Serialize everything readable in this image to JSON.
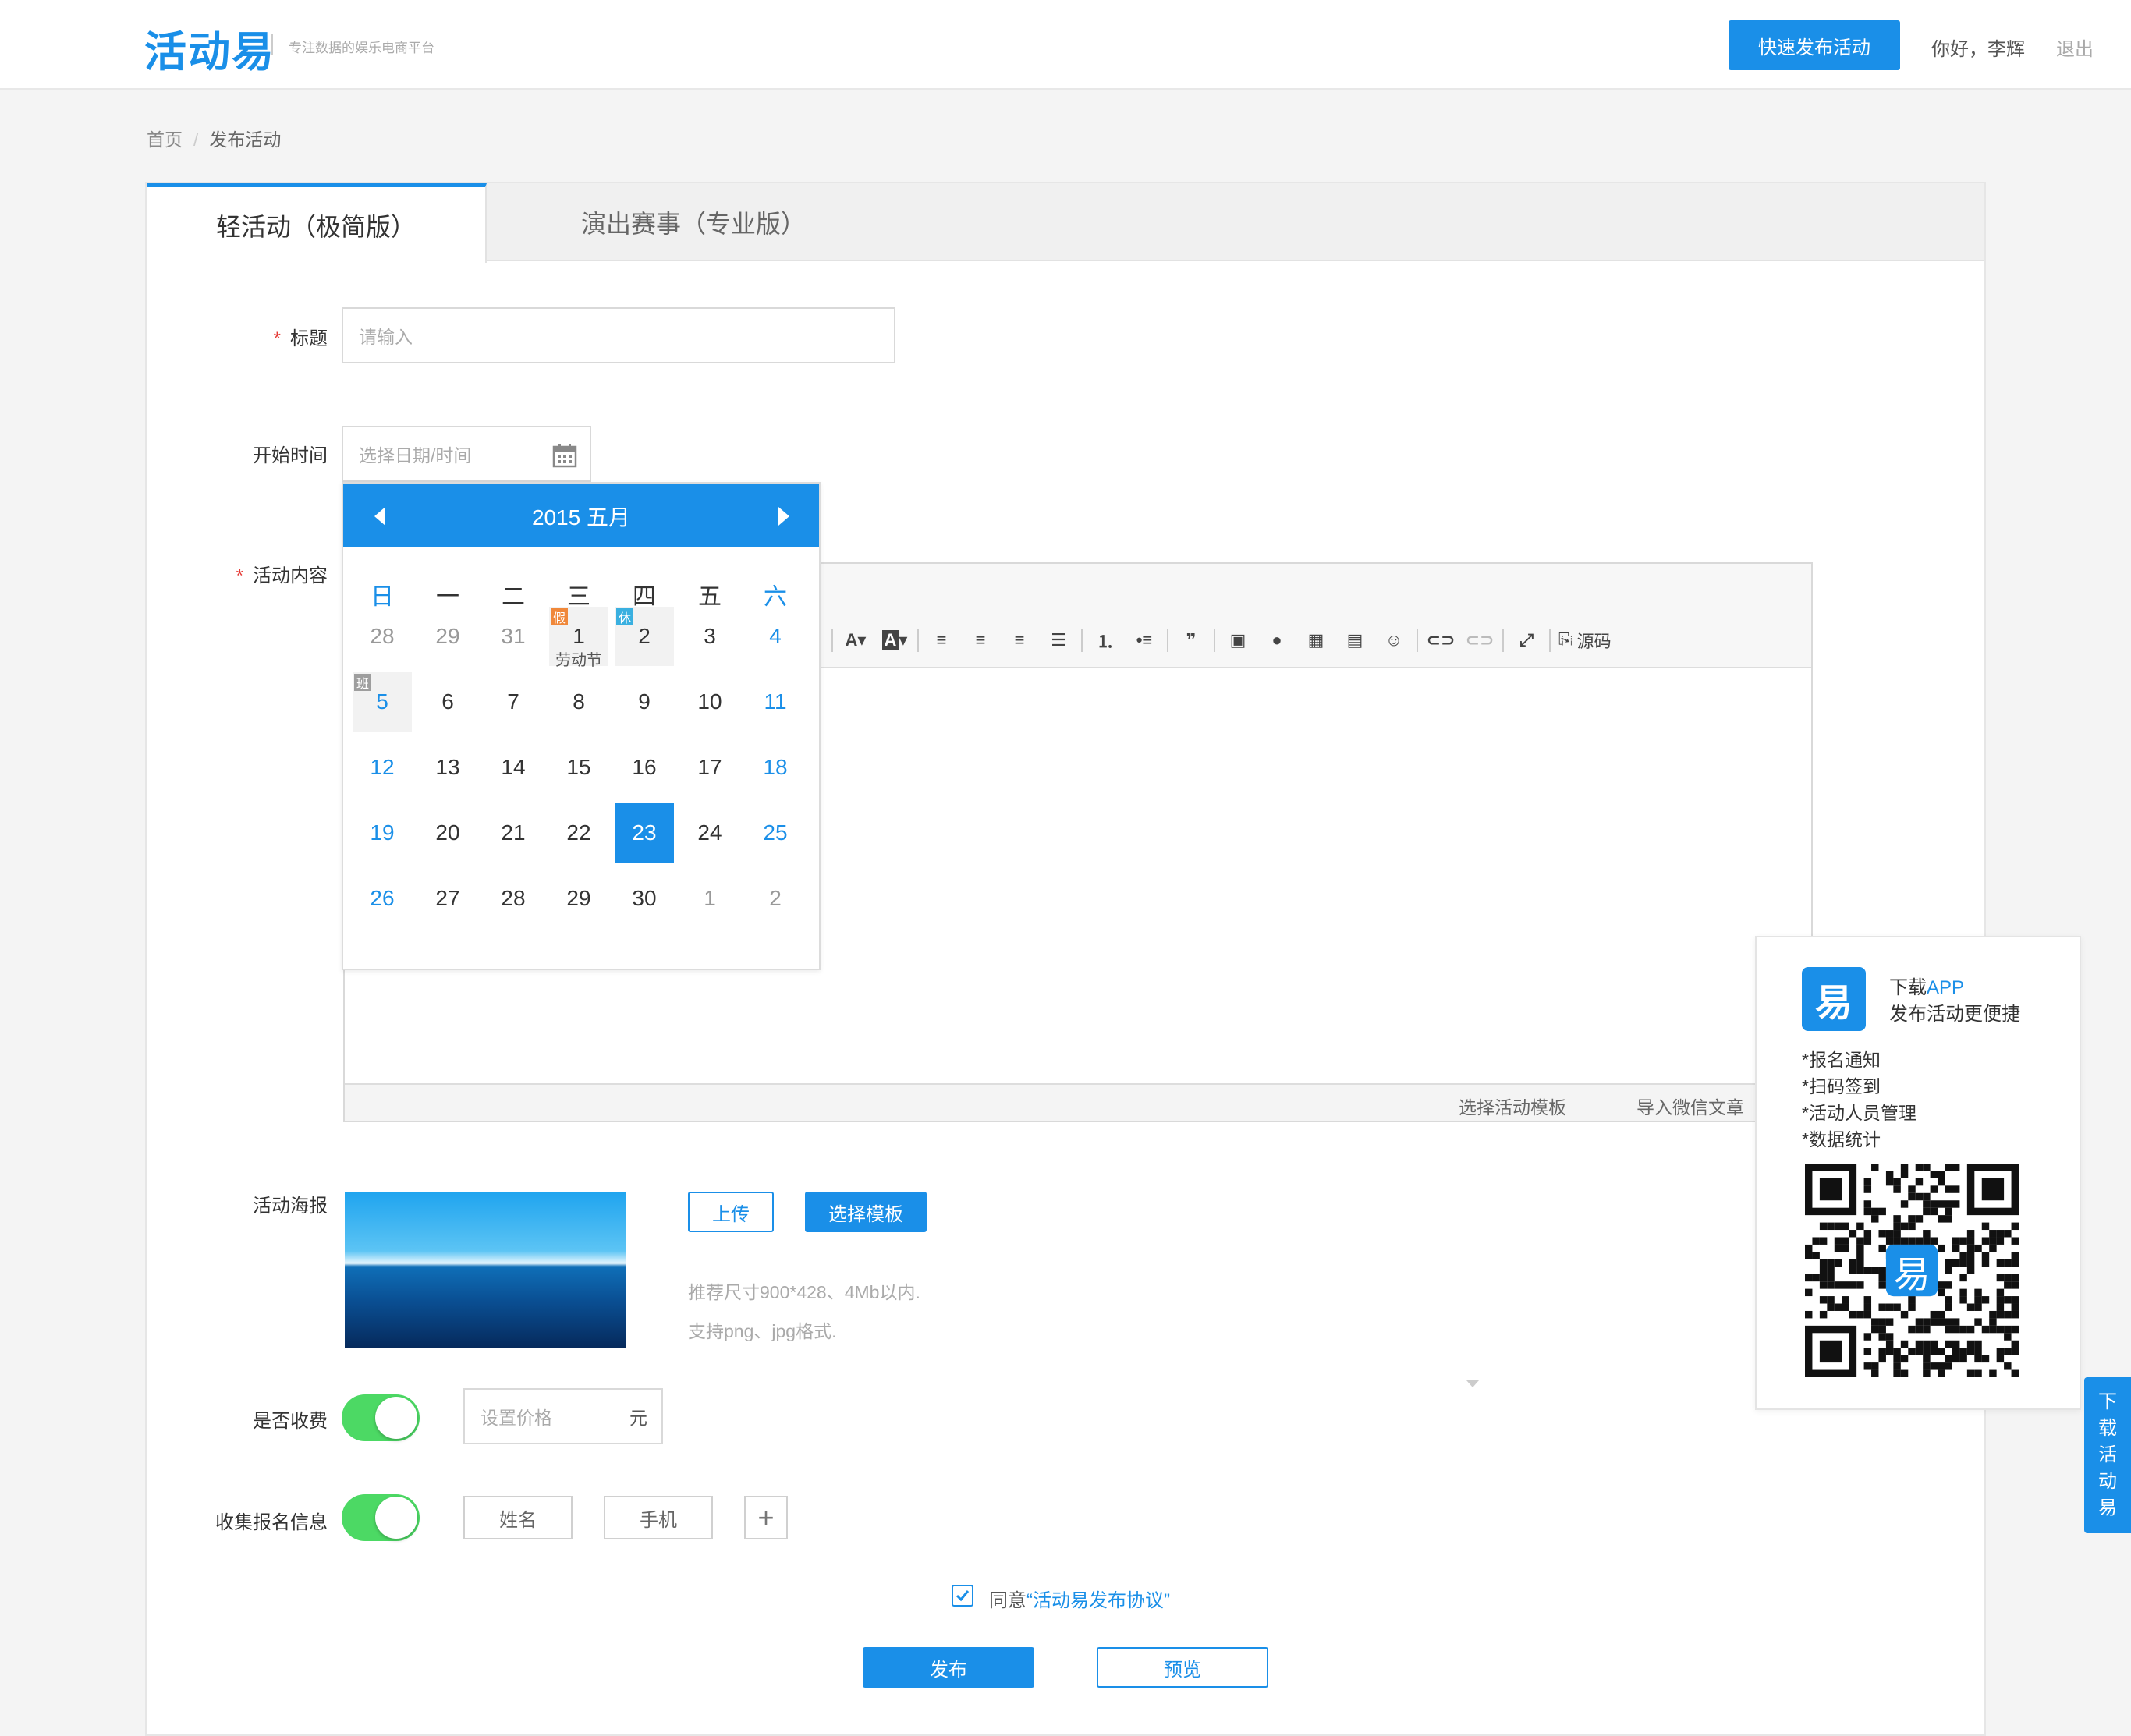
{
  "header": {
    "logo": "活动易",
    "slogan": "专注数据的娱乐电商平台",
    "quick_publish": "快速发布活动",
    "greeting": "你好，李辉",
    "logout": "退出"
  },
  "breadcrumb": {
    "home": "首页",
    "separator": "/",
    "current": "发布活动"
  },
  "tabs": [
    {
      "label": "轻活动（极简版）",
      "active": true
    },
    {
      "label": "演出赛事（专业版）",
      "active": false
    }
  ],
  "form": {
    "title_label": "标题",
    "title_placeholder": "请输入",
    "start_label": "开始时间",
    "start_placeholder": "选择日期/时间",
    "content_label": "活动内容",
    "poster_label": "活动海报",
    "upload": "上传",
    "choose_template": "选择模板",
    "hint1": "推荐尺寸900*428、4Mb以内.",
    "hint2": "支持png、jpg格式.",
    "fee_label": "是否收费",
    "price_placeholder": "设置价格",
    "price_unit": "元",
    "collect_label": "收集报名信息",
    "field_name": "姓名",
    "field_phone": "手机",
    "add": "+",
    "agree_prefix": "同意",
    "agree_link": "“活动易发布协议”",
    "publish": "发布",
    "preview": "预览"
  },
  "editor": {
    "source": "源码",
    "select_template": "选择活动模板",
    "import_wechat": "导入微信文章"
  },
  "calendar": {
    "title": "2015 五月",
    "weekdays": [
      "日",
      "一",
      "二",
      "三",
      "四",
      "五",
      "六"
    ],
    "rows": [
      [
        "28",
        "29",
        "31",
        "1",
        "2",
        "3",
        "4"
      ],
      [
        "5",
        "6",
        "7",
        "8",
        "9",
        "10",
        "11"
      ],
      [
        "12",
        "13",
        "14",
        "15",
        "16",
        "17",
        "18"
      ],
      [
        "19",
        "20",
        "21",
        "22",
        "23",
        "24",
        "25"
      ],
      [
        "26",
        "27",
        "28",
        "29",
        "30",
        "1",
        "2"
      ]
    ],
    "tag_jia": "假",
    "tag_xiu": "休",
    "tag_ban": "班",
    "holiday": "劳动节",
    "selected": "23",
    "colors": {
      "accent": "#1a8fe8",
      "jia": "#f0883a",
      "xiu": "#3ab0e0",
      "ban": "#9e9e9e"
    }
  },
  "app_panel": {
    "icon_char": "易",
    "download_prefix": "下载",
    "download_app": "APP",
    "subtitle": "发布活动更便捷",
    "features": [
      "*报名通知",
      "*扫码签到",
      "*活动人员管理",
      "*数据统计"
    ]
  },
  "side_tab": [
    "下",
    "载",
    "活",
    "动",
    "易"
  ]
}
